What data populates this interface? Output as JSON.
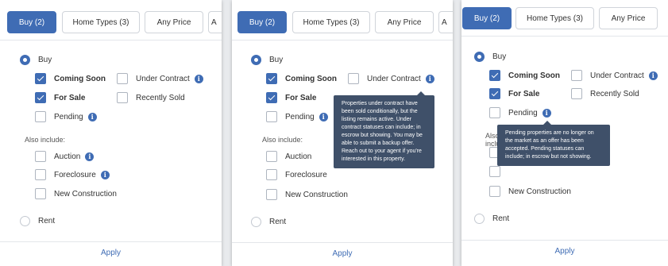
{
  "tabs": {
    "buy": "Buy (2)",
    "home_types": "Home Types (3)",
    "price": "Any Price",
    "more": "A"
  },
  "options": {
    "buy": "Buy",
    "coming_soon": "Coming Soon",
    "under_contract": "Under Contract",
    "for_sale": "For Sale",
    "recently_sold": "Recently Sold",
    "pending": "Pending",
    "also_include": "Also include:",
    "auction": "Auction",
    "foreclosure": "Foreclosure",
    "new_construction": "New Construction",
    "rent": "Rent",
    "apply": "Apply"
  },
  "state": {
    "buy_selected": true,
    "coming_soon": true,
    "for_sale": true,
    "under_contract": false,
    "recently_sold": false,
    "pending": false,
    "auction": false,
    "foreclosure": false,
    "new_construction": false,
    "rent_selected": false
  },
  "tooltips": {
    "under_contract": "Properties under contract have been sold conditionally, but the listing remains active. Under contract statuses can include; in escrow but showing. You may be able to submit a backup offer. Reach out to your agent if you're interested in this property.",
    "pending": "Pending properties are no longer on the market as an offer has been accepted. Pending statuses can include; in escrow but not showing."
  },
  "icons": {
    "info": "info-icon",
    "check": "check-icon"
  },
  "colors": {
    "accent": "#3f6cb4",
    "tooltip_bg": "#3f5069"
  }
}
